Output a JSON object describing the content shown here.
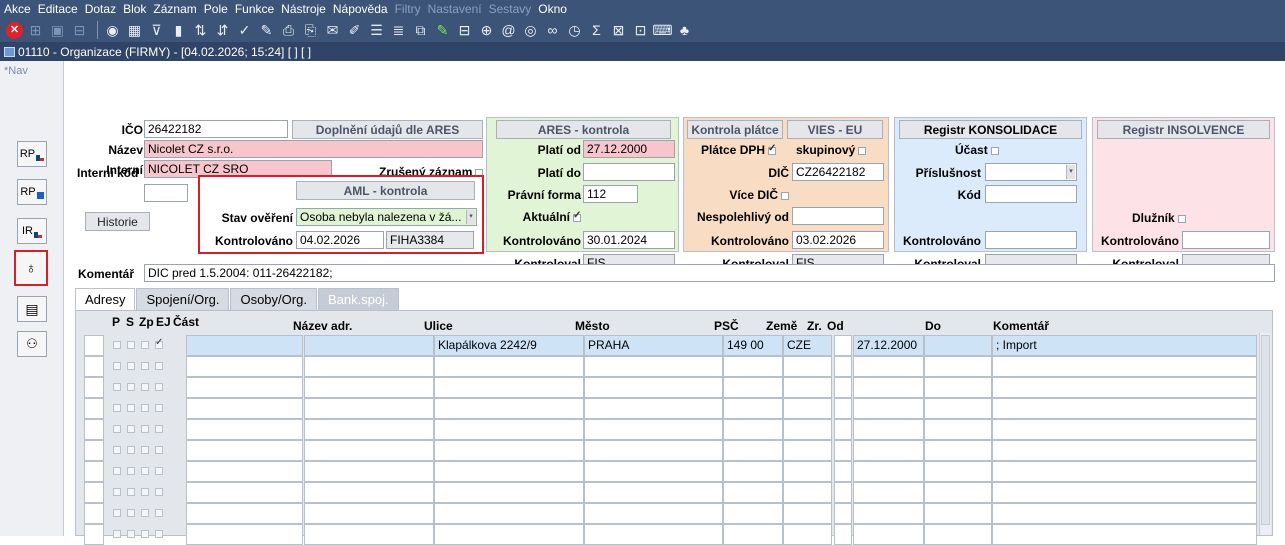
{
  "menu": [
    "Akce",
    "Editace",
    "Dotaz",
    "Blok",
    "Záznam",
    "Pole",
    "Funkce",
    "Nástroje",
    "Nápověda",
    "Filtry",
    "Nastavení",
    "Sestavy",
    "Okno"
  ],
  "window_title": "01110 - Organizace (FIRMY) - [04.02.2026; 15:24] [ ] [ ]",
  "nav_label": "Nav",
  "left_buttons": {
    "rp1": "RP",
    "rp2": "RP",
    "ir": "IR"
  },
  "ico": {
    "label": "IČO",
    "value": "26422182"
  },
  "nazev": {
    "label": "Název",
    "value": "Nicolet CZ s.r.o."
  },
  "interni": {
    "label": "Interní",
    "value": "NICOLET CZ SRO"
  },
  "interni_kod": {
    "label": "Interní kód",
    "value": ""
  },
  "zruseny": {
    "label": "Zrušený záznam"
  },
  "historie_button": "Historie",
  "ares_fill_button": "Doplnění údajů dle ARES",
  "aml": {
    "button": "AML - kontrola",
    "stav_label": "Stav ověření",
    "stav_value": "Osoba nebyla nalezena v žá...",
    "kontrolovano_label": "Kontrolováno",
    "kontrolovano_value": "04.02.2026",
    "kontroloval_value": "FIHA3384"
  },
  "ares": {
    "button": "ARES - kontrola",
    "plati_od_label": "Platí od",
    "plati_od_value": "27.12.2000",
    "plati_do_label": "Platí do",
    "plati_do_value": "",
    "pravni_forma_label": "Právní forma",
    "pravni_forma_value": "112",
    "aktualni_label": "Aktuální",
    "kontrolovano_label": "Kontrolováno",
    "kontrolovano_value": "30.01.2024",
    "kontroloval_label": "Kontroloval",
    "kontroloval_value": "FIS"
  },
  "platce": {
    "button": "Kontrola plátce",
    "vies_button": "VIES - EU",
    "platce_dph_label": "Plátce DPH",
    "skupinovy_label": "skupinový",
    "dic_label": "DIČ",
    "dic_value": "CZ26422182",
    "vice_dic_label": "Více DIČ",
    "nespolehlivy_label": "Nespolehlivý od",
    "nespolehlivy_value": "",
    "kontrolovano_label": "Kontrolováno",
    "kontrolovano_value": "03.02.2026",
    "kontroloval_label": "Kontroloval",
    "kontroloval_value": "FIS"
  },
  "konsolidace": {
    "title": "Registr KONSOLIDACE",
    "ucast_label": "Účast",
    "prislusnost_label": "Příslušnost",
    "kod_label": "Kód",
    "kontrolovano_label": "Kontrolováno",
    "kontroloval_label": "Kontroloval"
  },
  "insolvence": {
    "title": "Registr INSOLVENCE",
    "dluznik_label": "Dlužník",
    "kontrolovano_label": "Kontrolováno",
    "kontroloval_label": "Kontroloval"
  },
  "komentar": {
    "label": "Komentář",
    "value": "DIC pred 1.5.2004: 011-26422182;"
  },
  "tabs": [
    "Adresy",
    "Spojení/Org.",
    "Osoby/Org.",
    "Bank.spoj."
  ],
  "grid": {
    "columns": {
      "p": "P",
      "s": "S",
      "zp": "Zp",
      "ej": "EJ",
      "cast": "Část",
      "nazev": "Název adr.",
      "ulice": "Ulice",
      "mesto": "Město",
      "psc": "PSČ",
      "zeme": "Země",
      "zr": "Zr.",
      "od": "Od",
      "do": "Do",
      "komentar": "Komentář"
    },
    "row1": {
      "ulice": "Klapálkova 2242/9",
      "mesto": "PRAHA",
      "psc": "149 00",
      "zeme": "CZE",
      "od": "27.12.2000",
      "komentar": "; Import"
    }
  },
  "colors": {
    "chrome": "#3c5478",
    "pink": "#f6c6cc",
    "green_panel": "#e2f4d6",
    "orange_panel": "#f9dcc4",
    "blue_panel": "#dcebfb",
    "pink_panel": "#fde2e8",
    "highlight": "#d81e26"
  }
}
